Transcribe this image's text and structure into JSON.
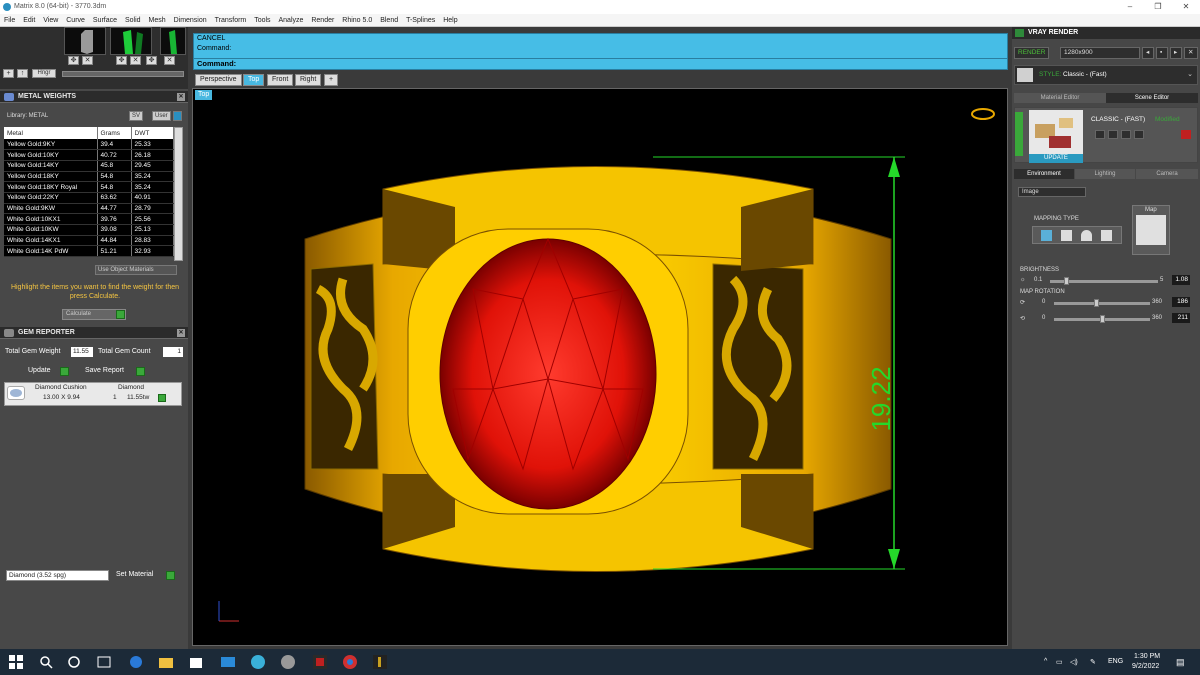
{
  "window": {
    "title": "Matrix 8.0 (64-bit) - 3770.3dm"
  },
  "menu": [
    "File",
    "Edit",
    "View",
    "Curve",
    "Surface",
    "Solid",
    "Mesh",
    "Dimension",
    "Transform",
    "Tools",
    "Analyze",
    "Render",
    "Rhino 5.0",
    "Blend",
    "T-Splines",
    "Help"
  ],
  "toolstrip": {
    "hinge_label": "Hngr"
  },
  "metal_weights": {
    "title": "METAL WEIGHTS",
    "library_label": "Library: METAL",
    "btn_sv": "SV",
    "btn_user": "User",
    "columns": [
      "Metal",
      "Grams",
      "DWT"
    ],
    "rows": [
      [
        "Yellow Gold:9KY",
        "39.4",
        "25.33"
      ],
      [
        "Yellow Gold:10KY",
        "40.72",
        "26.18"
      ],
      [
        "Yellow Gold:14KY",
        "45.8",
        "29.45"
      ],
      [
        "Yellow Gold:18KY",
        "54.8",
        "35.24"
      ],
      [
        "Yellow Gold:18KY Royal",
        "54.8",
        "35.24"
      ],
      [
        "Yellow Gold:22KY",
        "63.62",
        "40.91"
      ],
      [
        "White Gold:9KW",
        "44.77",
        "28.79"
      ],
      [
        "White Gold:10KX1",
        "39.76",
        "25.56"
      ],
      [
        "White Gold:10KW",
        "39.08",
        "25.13"
      ],
      [
        "White Gold:14KX1",
        "44.84",
        "28.83"
      ],
      [
        "White Gold:14K PdW",
        "51.21",
        "32.93"
      ]
    ],
    "use_object_materials": "Use Object Materials",
    "hint": "Highlight the items you want to find the weight for then press Calculate.",
    "calculate_label": "Calculate"
  },
  "gem_reporter": {
    "title": "GEM REPORTER",
    "total_weight_label": "Total Gem Weight",
    "total_weight_value": "11.55",
    "total_count_label": "Total Gem Count",
    "total_count_value": "1",
    "update_label": "Update",
    "save_report_label": "Save Report",
    "gem_cut": "Diamond Cushion",
    "gem_material": "Diamond",
    "gem_size": "13.00 X 9.94",
    "gem_count": "1",
    "gem_weight": "11.55tw",
    "material_select": "Diamond   (3.52 spg)",
    "set_material_label": "Set Material"
  },
  "command": {
    "line1": "CANCEL",
    "line2": "Command:",
    "prompt": "Command:"
  },
  "viewport_tabs": [
    "Perspective",
    "Top",
    "Front",
    "Right",
    "+"
  ],
  "viewport_label": "Top",
  "dimension_value": "19.22",
  "vray": {
    "title": "VRAY RENDER",
    "render_label": "RENDER",
    "resolution": "1280x900",
    "style_label": "STYLE:",
    "style_value": "Classic - (Fast)",
    "material_editor_tab": "Material Editor",
    "scene_editor_tab": "Scene Editor",
    "scene_name": "CLASSIC - (FAST)",
    "scene_modified": "Modified",
    "update_label": "UPDATE",
    "env_tab": "Environment",
    "lighting_tab": "Lighting",
    "camera_tab": "Camera",
    "env_type": "Image",
    "mapping_type_label": "MAPPING TYPE",
    "map_label": "Map",
    "brightness_label": "BRIGHTNESS",
    "brightness_min": "0.1",
    "brightness_max": "5",
    "brightness_value": "1.08",
    "map_rotation_label": "MAP ROTATION",
    "rot_min": "0",
    "rot_max": "360",
    "rot_h_value": "186",
    "rot_v_value": "211",
    "accent": "#4cbf3a"
  },
  "taskbar": {
    "lang": "ENG",
    "time": "1:30 PM",
    "date": "9/2/2022"
  }
}
